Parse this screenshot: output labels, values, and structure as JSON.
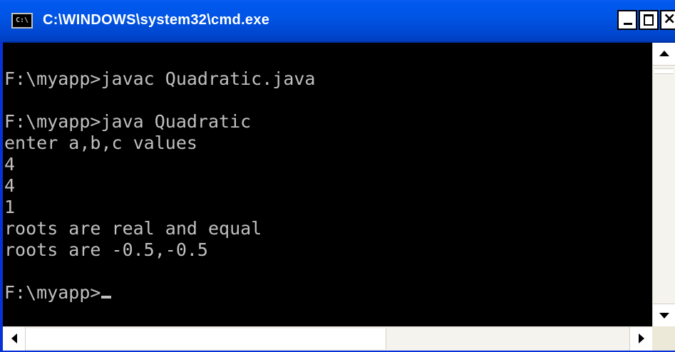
{
  "window": {
    "title": "C:\\WINDOWS\\system32\\cmd.exe",
    "icon": "cmd-icon",
    "icon_label": "C:\\",
    "controls": {
      "minimize": "minimize-icon",
      "maximize": "maximize-icon",
      "close": "close-icon",
      "close_glyph": "×"
    }
  },
  "console": {
    "lines": [
      "",
      "F:\\myapp>javac Quadratic.java",
      "",
      "F:\\myapp>java Quadratic",
      "enter a,b,c values",
      "4",
      "4",
      "1",
      "roots are real and equal",
      "roots are -0.5,-0.5",
      "",
      "F:\\myapp>"
    ],
    "background": "#000000",
    "foreground": "#c0c0c0"
  },
  "colors": {
    "titlebar": "#0055e5",
    "frame": "#0831d9",
    "scrollbar_track": "#f4f3ee"
  }
}
